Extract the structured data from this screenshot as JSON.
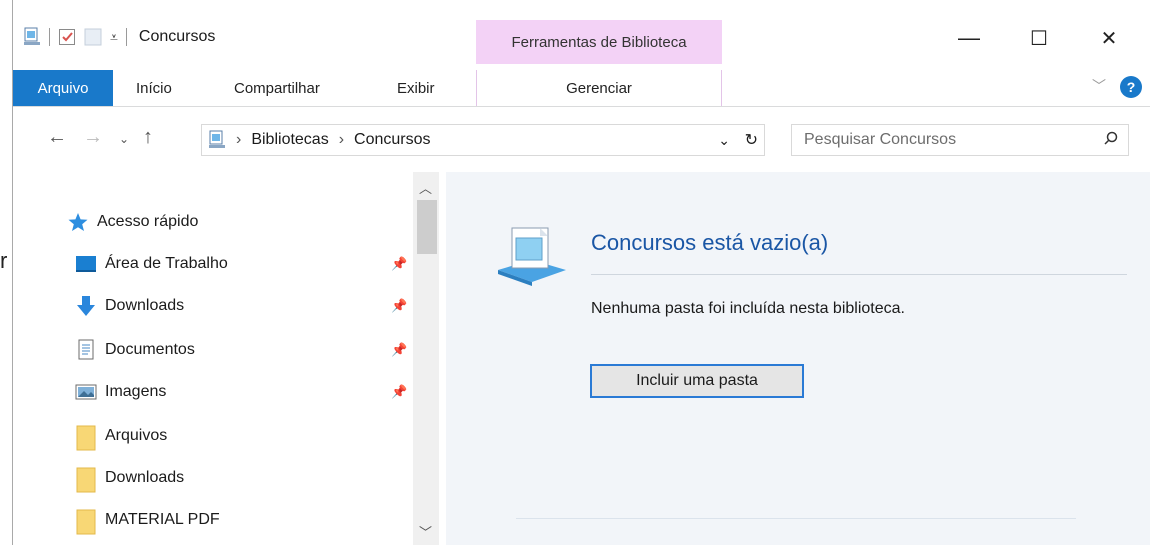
{
  "window": {
    "title": "Concursos",
    "controls": {
      "minimize": "—",
      "maximize": "☐",
      "close": "✕"
    }
  },
  "context_tab": {
    "group": "Ferramentas de Biblioteca",
    "subtab": "Gerenciar"
  },
  "ribbon": {
    "tabs": [
      {
        "label": "Arquivo"
      },
      {
        "label": "Início"
      },
      {
        "label": "Compartilhar"
      },
      {
        "label": "Exibir"
      }
    ],
    "help": "?"
  },
  "address": {
    "crumbs": [
      "Bibliotecas",
      "Concursos"
    ],
    "search_placeholder": "Pesquisar Concursos"
  },
  "nav": {
    "quick_access": "Acesso rápido",
    "items": [
      {
        "label": "Área de Trabalho",
        "icon": "desktop-icon",
        "pinned": true
      },
      {
        "label": "Downloads",
        "icon": "download-arrow-icon",
        "pinned": true
      },
      {
        "label": "Documentos",
        "icon": "documents-icon",
        "pinned": true
      },
      {
        "label": "Imagens",
        "icon": "pictures-icon",
        "pinned": true
      },
      {
        "label": "Arquivos",
        "icon": "folder-icon",
        "pinned": false
      },
      {
        "label": "Downloads",
        "icon": "folder-icon",
        "pinned": false
      },
      {
        "label": "MATERIAL PDF",
        "icon": "folder-icon",
        "pinned": false
      }
    ]
  },
  "content": {
    "title": "Concursos está vazio(a)",
    "message": "Nenhuma pasta foi incluída nesta biblioteca.",
    "button": "Incluir uma pasta"
  },
  "background_fragment": "r",
  "colors": {
    "accent": "#1979ca",
    "context": "#f3d2f6",
    "link_title": "#1a56a5"
  }
}
